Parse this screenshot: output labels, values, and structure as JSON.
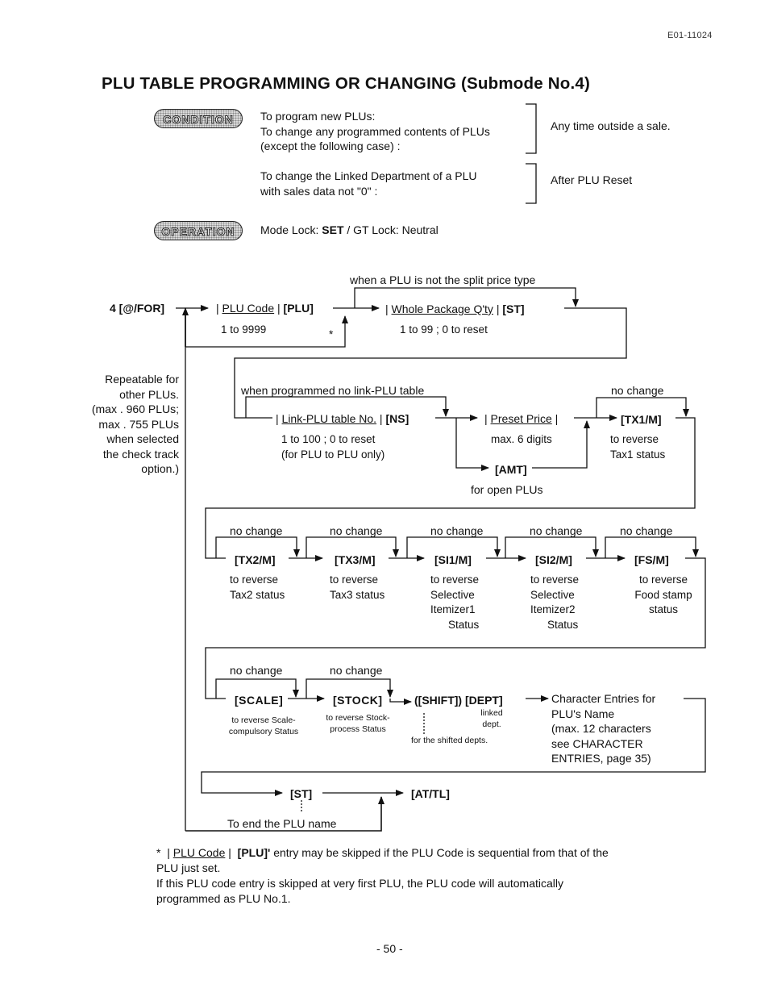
{
  "header": {
    "doc_number": "E01-11024",
    "title": "PLU TABLE PROGRAMMING OR CHANGING  (Submode No.4)"
  },
  "condition": {
    "badge": "CONDITION",
    "group1": {
      "lines": [
        "To program new PLUs:",
        "To change any programmed contents of PLUs",
        "(except the following case) :"
      ],
      "result": "Any time outside a sale."
    },
    "group2": {
      "lines": [
        "To change the Linked Department of a PLU",
        "with sales data not \"0\" :"
      ],
      "result": "After PLU Reset"
    }
  },
  "operation": {
    "badge": "OPERATION",
    "mode_lock_label": "Mode Lock: ",
    "mode_lock_value": "SET",
    "gt_lock": " / GT Lock: Neutral"
  },
  "flow": {
    "start_key": "4 [@/FOR]",
    "plu_code": {
      "label": "PLU Code",
      "key": "[PLU]",
      "range": "1 to 9999",
      "asterisk": "*"
    },
    "split_note": "when a PLU is not the split price type",
    "whole_package": {
      "label": "Whole Package Q'ty",
      "key": "[ST]",
      "range": "1 to 99 ; 0 to reset"
    },
    "repeat_note": [
      "Repeatable for",
      "other PLUs.",
      "(max . 960 PLUs;",
      "max . 755 PLUs",
      "when selected",
      "the check track",
      "option.)"
    ],
    "link_note": "when programmed no link-PLU table",
    "link_plu": {
      "label": "Link-PLU table No.",
      "key": "[NS]",
      "range": [
        "1 to 100 ; 0 to reset",
        "(for PLU to PLU only)"
      ]
    },
    "preset_price": {
      "label": "Preset Price",
      "range": "max. 6 digits"
    },
    "amt": {
      "key": "[AMT]",
      "note": "for open PLUs"
    },
    "tx1": {
      "key": "[TX1/M]",
      "skip": "no change",
      "desc": [
        "to reverse",
        "Tax1 status"
      ]
    },
    "row2": [
      {
        "key": "[TX2/M]",
        "skip": "no change",
        "desc": [
          "to reverse",
          "Tax2 status"
        ]
      },
      {
        "key": "[TX3/M]",
        "skip": "no change",
        "desc": [
          "to reverse",
          "Tax3 status"
        ]
      },
      {
        "key": "[SI1/M]",
        "skip": "no change",
        "desc": [
          "to reverse",
          "Selective",
          "Itemizer1",
          "Status"
        ]
      },
      {
        "key": "[SI2/M]",
        "skip": "no change",
        "desc": [
          "to reverse",
          "Selective",
          "Itemizer2",
          "Status"
        ]
      },
      {
        "key": "[FS/M]",
        "skip": "no change",
        "desc": [
          "to reverse",
          "Food stamp",
          "status"
        ]
      }
    ],
    "row3": {
      "scale": {
        "key": "[SCALE]",
        "skip": "no change",
        "desc": [
          "to reverse Scale-",
          "compulsory Status"
        ]
      },
      "stock": {
        "key": "[STOCK]",
        "skip": "no change",
        "desc": [
          "to reverse Stock-",
          "process Status"
        ]
      },
      "shift_dept": {
        "key": "([SHIFT]) [DEPT]",
        "linked": [
          "linked",
          "dept."
        ],
        "shift_note": "for the shifted depts."
      },
      "char_entries": [
        "Character Entries for",
        "PLU's Name",
        "(max. 12 characters",
        "see CHARACTER",
        "ENTRIES, page 35)"
      ]
    },
    "row4": {
      "st_key": "[ST]",
      "end_key": "[AT/TL]",
      "end_note": "To end the PLU name"
    }
  },
  "footnote": {
    "star": "*",
    "plu_code": "PLU Code",
    "plu_key": "[PLU]'",
    "line1_rest": " entry may be skipped if the PLU Code is sequential from that of the",
    "line2": "PLU just set.",
    "line3": "If this PLU code entry is skipped at very first PLU, the PLU code will automatically",
    "line4": "programmed as PLU No.1."
  },
  "page_number": "- 50 -"
}
